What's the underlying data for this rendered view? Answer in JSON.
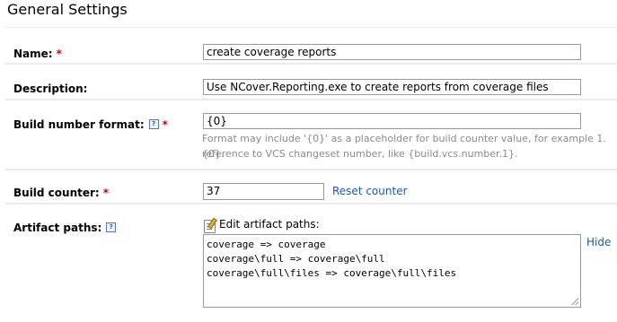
{
  "page": {
    "title": "General Settings"
  },
  "name": {
    "label": "Name:",
    "required": "*",
    "value": "create coverage reports"
  },
  "description": {
    "label": "Description:",
    "value": "Use NCover.Reporting.exe to create reports from coverage files"
  },
  "build_number_format": {
    "label": "Build number format:",
    "required": "*",
    "help_icon": "question-icon",
    "value": "{0}",
    "note_line1": "Format may include '{0}' as a placeholder for build counter value, for example 1.{0}.",
    "note_line2": "reference to VCS changeset number, like {build.vcs.number.1}."
  },
  "build_counter": {
    "label": "Build counter:",
    "required": "*",
    "value": "37",
    "reset_link": "Reset counter"
  },
  "artifact_paths": {
    "label": "Artifact paths:",
    "help_icon": "question-icon",
    "edit_label": "Edit artifact paths:",
    "hide_link": "Hide",
    "lines": [
      "coverage => coverage",
      "coverage\\full => coverage\\full",
      "coverage\\full\\files => coverage\\full\\files"
    ]
  },
  "colors": {
    "required": "#cc0000",
    "link": "#1f5aa8",
    "panel_background": "#ebebeb",
    "note_text": "#8a8a8a"
  }
}
